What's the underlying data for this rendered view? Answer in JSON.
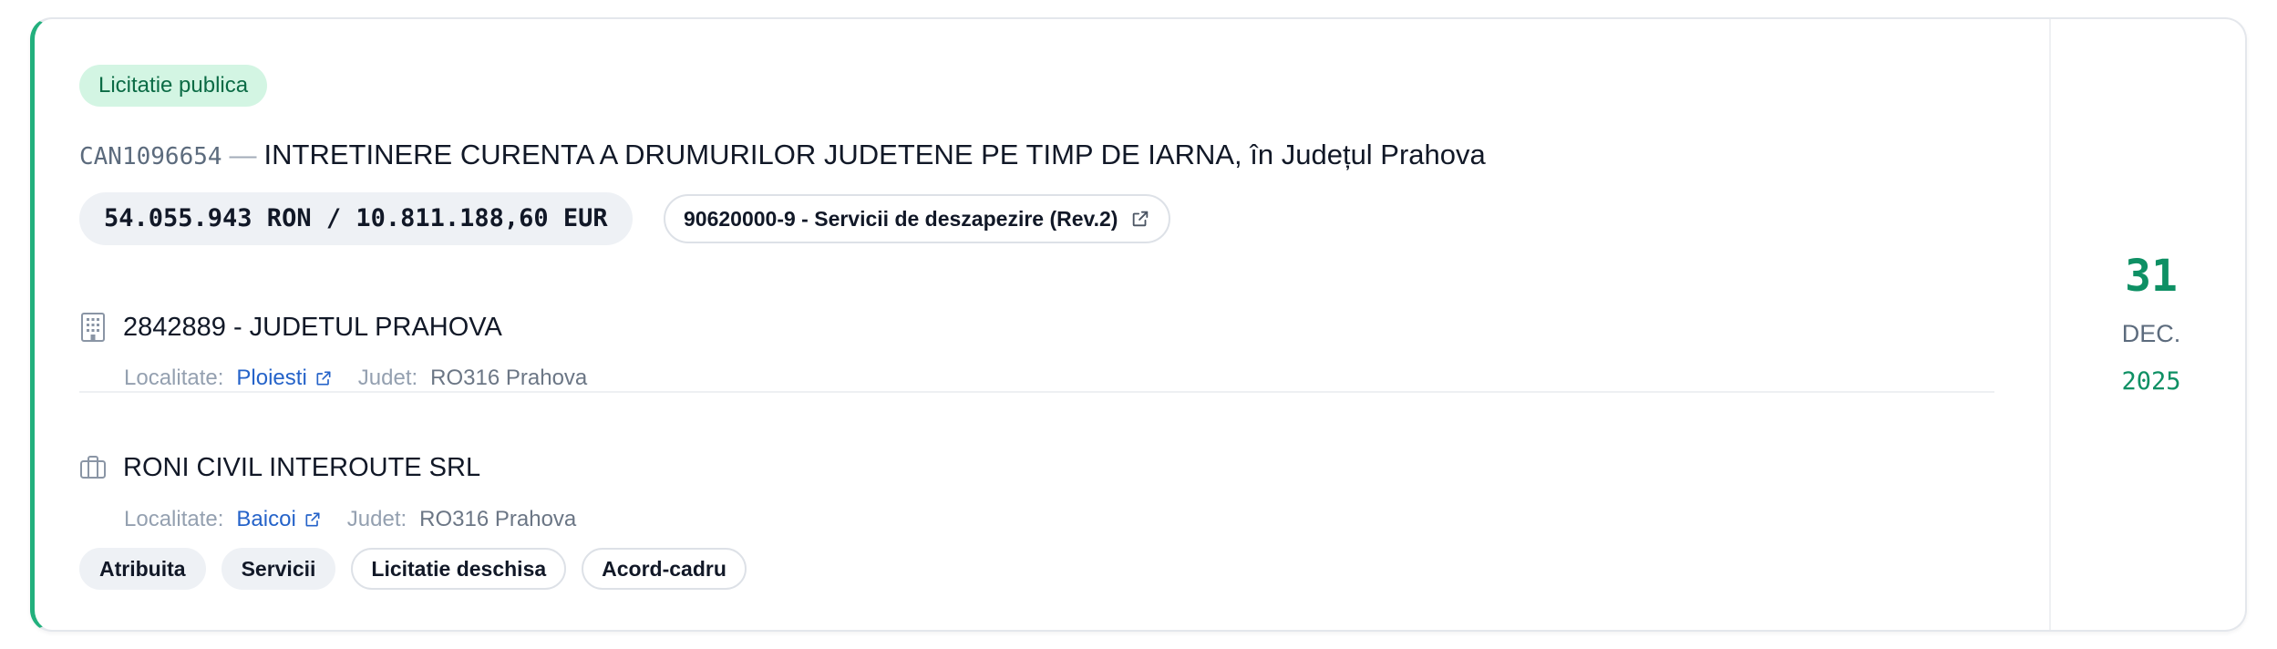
{
  "procedure": {
    "type_badge": "Licitatie publica",
    "tender_id": "CAN1096654",
    "separator": "—",
    "title": "INTRETINERE CURENTA A DRUMURILOR JUDETENE PE TIMP DE IARNA, în Județul Prahova",
    "value": "54.055.943 RON / 10.811.188,60 EUR",
    "cpv": "90620000-9 - Servicii de deszapezire (Rev.2)"
  },
  "authority": {
    "name": "2842889 - JUDETUL PRAHOVA",
    "icon": "building-icon",
    "locality_label": "Localitate:",
    "locality": "Ploiesti",
    "county_label": "Judet:",
    "county": "RO316 Prahova"
  },
  "supplier": {
    "name": "RONI CIVIL INTEROUTE SRL",
    "icon": "briefcase-icon",
    "locality_label": "Localitate:",
    "locality": "Baicoi",
    "county_label": "Judet:",
    "county": "RO316 Prahova"
  },
  "tags": [
    {
      "label": "Atribuita",
      "style": "filled"
    },
    {
      "label": "Servicii",
      "style": "filled"
    },
    {
      "label": "Licitatie deschisa",
      "style": "outlined"
    },
    {
      "label": "Acord-cadru",
      "style": "outlined"
    }
  ],
  "date": {
    "day": "31",
    "month": "DEC.",
    "year": "2025"
  },
  "colors": {
    "accent": "#22b07d",
    "date_green": "#0e9064",
    "badge_bg": "#d3f5e3",
    "link_blue": "#2563c9"
  }
}
